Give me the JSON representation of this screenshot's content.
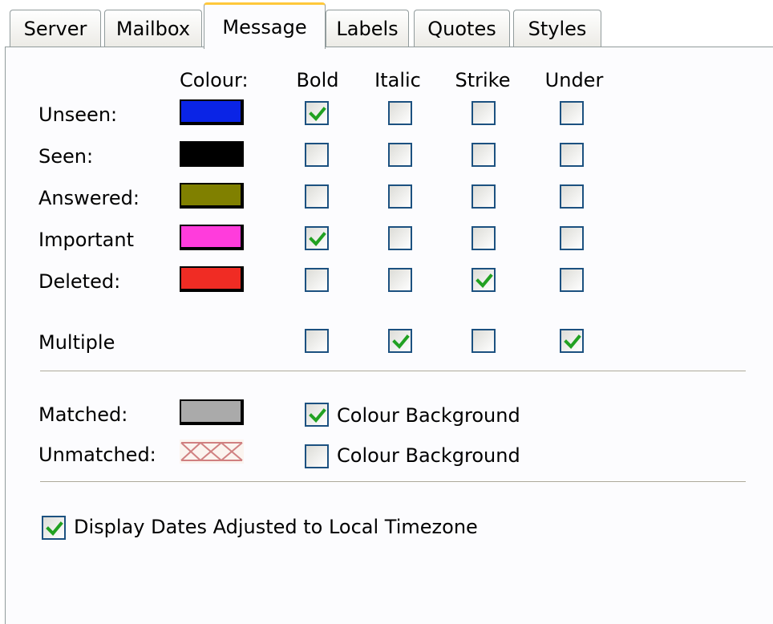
{
  "tabs": [
    {
      "label": "Server",
      "active": false
    },
    {
      "label": "Mailbox",
      "active": false
    },
    {
      "label": "Message",
      "active": true
    },
    {
      "label": "Labels",
      "active": false
    },
    {
      "label": "Quotes",
      "active": false
    },
    {
      "label": "Styles",
      "active": false
    }
  ],
  "columns": {
    "colour": "Colour:",
    "bold": "Bold",
    "italic": "Italic",
    "strike": "Strike",
    "under": "Under"
  },
  "rows": [
    {
      "label": "Unseen:",
      "color": "#0a24e6",
      "bold": true,
      "italic": false,
      "strike": false,
      "under": false
    },
    {
      "label": "Seen:",
      "color": "#000000",
      "bold": false,
      "italic": false,
      "strike": false,
      "under": false
    },
    {
      "label": "Answered:",
      "color": "#808000",
      "bold": false,
      "italic": false,
      "strike": false,
      "under": false
    },
    {
      "label": "Important",
      "color": "#ff3cdc",
      "bold": true,
      "italic": false,
      "strike": false,
      "under": false
    },
    {
      "label": "Deleted:",
      "color": "#f02c24",
      "bold": false,
      "italic": false,
      "strike": true,
      "under": false
    }
  ],
  "multiple": {
    "label": "Multiple",
    "bold": false,
    "italic": true,
    "strike": false,
    "under": true
  },
  "matched": {
    "label": "Matched:",
    "color": "#aaaaaa",
    "colour_background_label": "Colour Background",
    "colour_background": true
  },
  "unmatched": {
    "label": "Unmatched:",
    "colour_background_label": "Colour Background",
    "colour_background": false
  },
  "display_dates": {
    "label": "Display Dates Adjusted to Local Timezone",
    "checked": true
  },
  "colors": {
    "check": "#21a121",
    "checkbox_border": "#1c5180",
    "tab_highlight": "#ffc83c"
  }
}
